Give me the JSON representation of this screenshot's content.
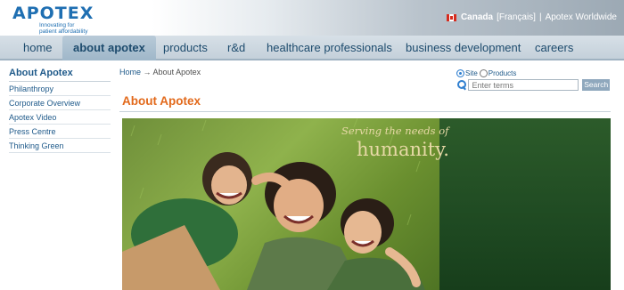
{
  "header": {
    "logo_text": "APOTEX",
    "logo_tagline_1": "Innovating for",
    "logo_tagline_2": "patient affordability",
    "country": "Canada",
    "language_link": "[Français]",
    "separator": "|",
    "worldwide_link": "Apotex Worldwide"
  },
  "nav": {
    "items": [
      {
        "label": "home"
      },
      {
        "label": "about apotex",
        "active": true
      },
      {
        "label": "products"
      },
      {
        "label": "r&d"
      },
      {
        "label": "healthcare professionals"
      },
      {
        "label": "business development"
      },
      {
        "label": "careers"
      }
    ]
  },
  "sidebar": {
    "title": "About Apotex",
    "items": [
      {
        "label": "Philanthropy"
      },
      {
        "label": "Corporate Overview"
      },
      {
        "label": "Apotex Video"
      },
      {
        "label": "Press Centre"
      },
      {
        "label": "Thinking Green"
      }
    ]
  },
  "breadcrumb": {
    "home": "Home",
    "arrow": "→",
    "current": "About Apotex"
  },
  "search": {
    "scope_site": "Site",
    "scope_products": "Products",
    "selected_scope": "Site",
    "placeholder": "Enter terms",
    "button_label": "Search"
  },
  "main": {
    "title": "About Apotex"
  },
  "hero": {
    "tagline_line1": "Serving the needs of",
    "tagline_line2": "humanity."
  },
  "colors": {
    "brand_blue": "#1f6fb2",
    "title_orange": "#e2691b",
    "panel_green": "#1f4a22",
    "tagline_gold": "#e7d9a6"
  }
}
